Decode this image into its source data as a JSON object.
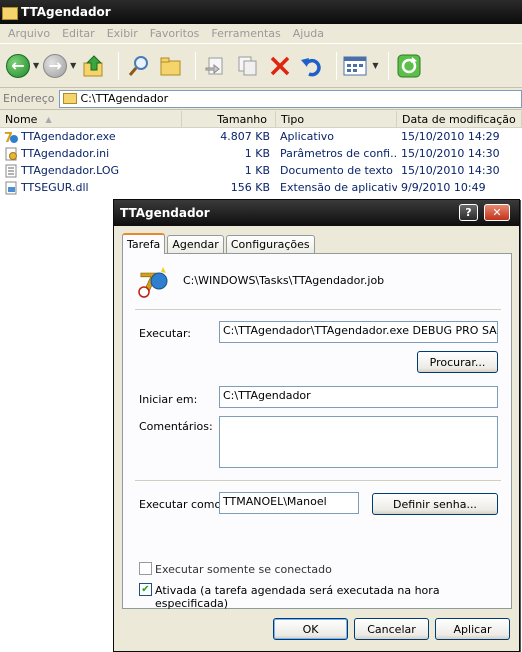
{
  "window": {
    "title": "TTAgendador"
  },
  "menu": [
    "Arquivo",
    "Editar",
    "Exibir",
    "Favoritos",
    "Ferramentas",
    "Ajuda"
  ],
  "address": {
    "label": "Endereço",
    "value": "C:\\TTAgendador"
  },
  "columns": {
    "name": "Nome",
    "size": "Tamanho",
    "type": "Tipo",
    "date": "Data de modificação"
  },
  "files": [
    {
      "name": "TTAgendador.exe",
      "size": "4.807 KB",
      "type": "Aplicativo",
      "date": "15/10/2010 14:29",
      "icon": "app-icon"
    },
    {
      "name": "TTAgendador.ini",
      "size": "1 KB",
      "type": "Parâmetros de confi...",
      "date": "15/10/2010 14:30",
      "icon": "ini-file-icon"
    },
    {
      "name": "TTAgendador.LOG",
      "size": "1 KB",
      "type": "Documento de texto",
      "date": "15/10/2010 14:30",
      "icon": "text-file-icon"
    },
    {
      "name": "TTSEGUR.dll",
      "size": "156 KB",
      "type": "Extensão de aplicativo",
      "date": "9/9/2010 10:49",
      "icon": "dll-file-icon"
    }
  ],
  "dialog": {
    "title": "TTAgendador",
    "tabs": [
      "Tarefa",
      "Agendar",
      "Configurações"
    ],
    "job_path": "C:\\WINDOWS\\Tasks\\TTAgendador.job",
    "run_label": "Executar:",
    "run_value": "C:\\TTAgendador\\TTAgendador.exe DEBUG PRO SAL",
    "browse_label": "Procurar...",
    "start_in_label": "Iniciar em:",
    "start_in_value": "C:\\TTAgendador",
    "comments_label": "Comentários:",
    "comments_value": "",
    "run_as_label": "Executar como:",
    "run_as_value": "TTMANOEL\\Manoel",
    "set_password_label": "Definir senha...",
    "only_logged_label": "Executar somente se  conectado",
    "only_logged_checked": false,
    "enabled_label": "Ativada (a tarefa agendada será executada na hora especificada)",
    "enabled_checked": true,
    "ok_label": "OK",
    "cancel_label": "Cancelar",
    "apply_label": "Aplicar"
  }
}
